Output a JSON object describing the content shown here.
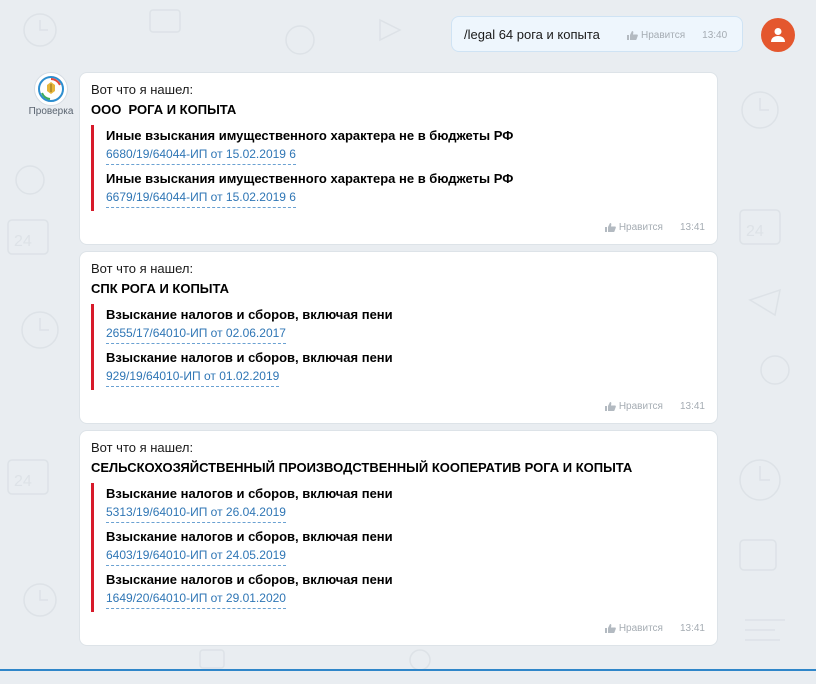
{
  "outgoing": {
    "text": "/legal 64 рога и копыта",
    "like_label": "Нравится",
    "time": "13:40"
  },
  "bot": {
    "name": "Проверка"
  },
  "results": [
    {
      "intro": "Вот что я нашел:",
      "company": "ООО  РОГА И КОПЫТА",
      "cases": [
        {
          "title": "Иные взыскания имущественного характера не в бюджеты РФ",
          "link": "6680/19/64044-ИП от 15.02.2019 6"
        },
        {
          "title": "Иные взыскания имущественного характера не в бюджеты РФ",
          "link": "6679/19/64044-ИП от 15.02.2019 6"
        }
      ],
      "like_label": "Нравится",
      "time": "13:41"
    },
    {
      "intro": "Вот что я нашел:",
      "company": "СПК РОГА И КОПЫТА",
      "cases": [
        {
          "title": "Взыскание налогов и сборов, включая пени",
          "link": "2655/17/64010-ИП от 02.06.2017"
        },
        {
          "title": "Взыскание налогов и сборов, включая пени",
          "link": "929/19/64010-ИП от 01.02.2019"
        }
      ],
      "like_label": "Нравится",
      "time": "13:41"
    },
    {
      "intro": "Вот что я нашел:",
      "company": "СЕЛЬСКОХОЗЯЙСТВЕННЫЙ ПРОИЗВОДСТВЕННЫЙ КООПЕРАТИВ РОГА И КОПЫТА",
      "cases": [
        {
          "title": "Взыскание налогов и сборов, включая пени",
          "link": "5313/19/64010-ИП от 26.04.2019"
        },
        {
          "title": "Взыскание налогов и сборов, включая пени",
          "link": "6403/19/64010-ИП от 24.05.2019"
        },
        {
          "title": "Взыскание налогов и сборов, включая пени",
          "link": "1649/20/64010-ИП от 29.01.2020"
        }
      ],
      "like_label": "Нравится",
      "time": "13:41"
    }
  ],
  "colors": {
    "accent_bar": "#d71a2a",
    "link": "#2f76b5",
    "user_avatar": "#e4572e",
    "bottom_line": "#2f86c9"
  },
  "icons": {
    "user_avatar": "person-icon",
    "bot_avatar": "emblem-icon",
    "like": "thumbs-up-icon"
  }
}
